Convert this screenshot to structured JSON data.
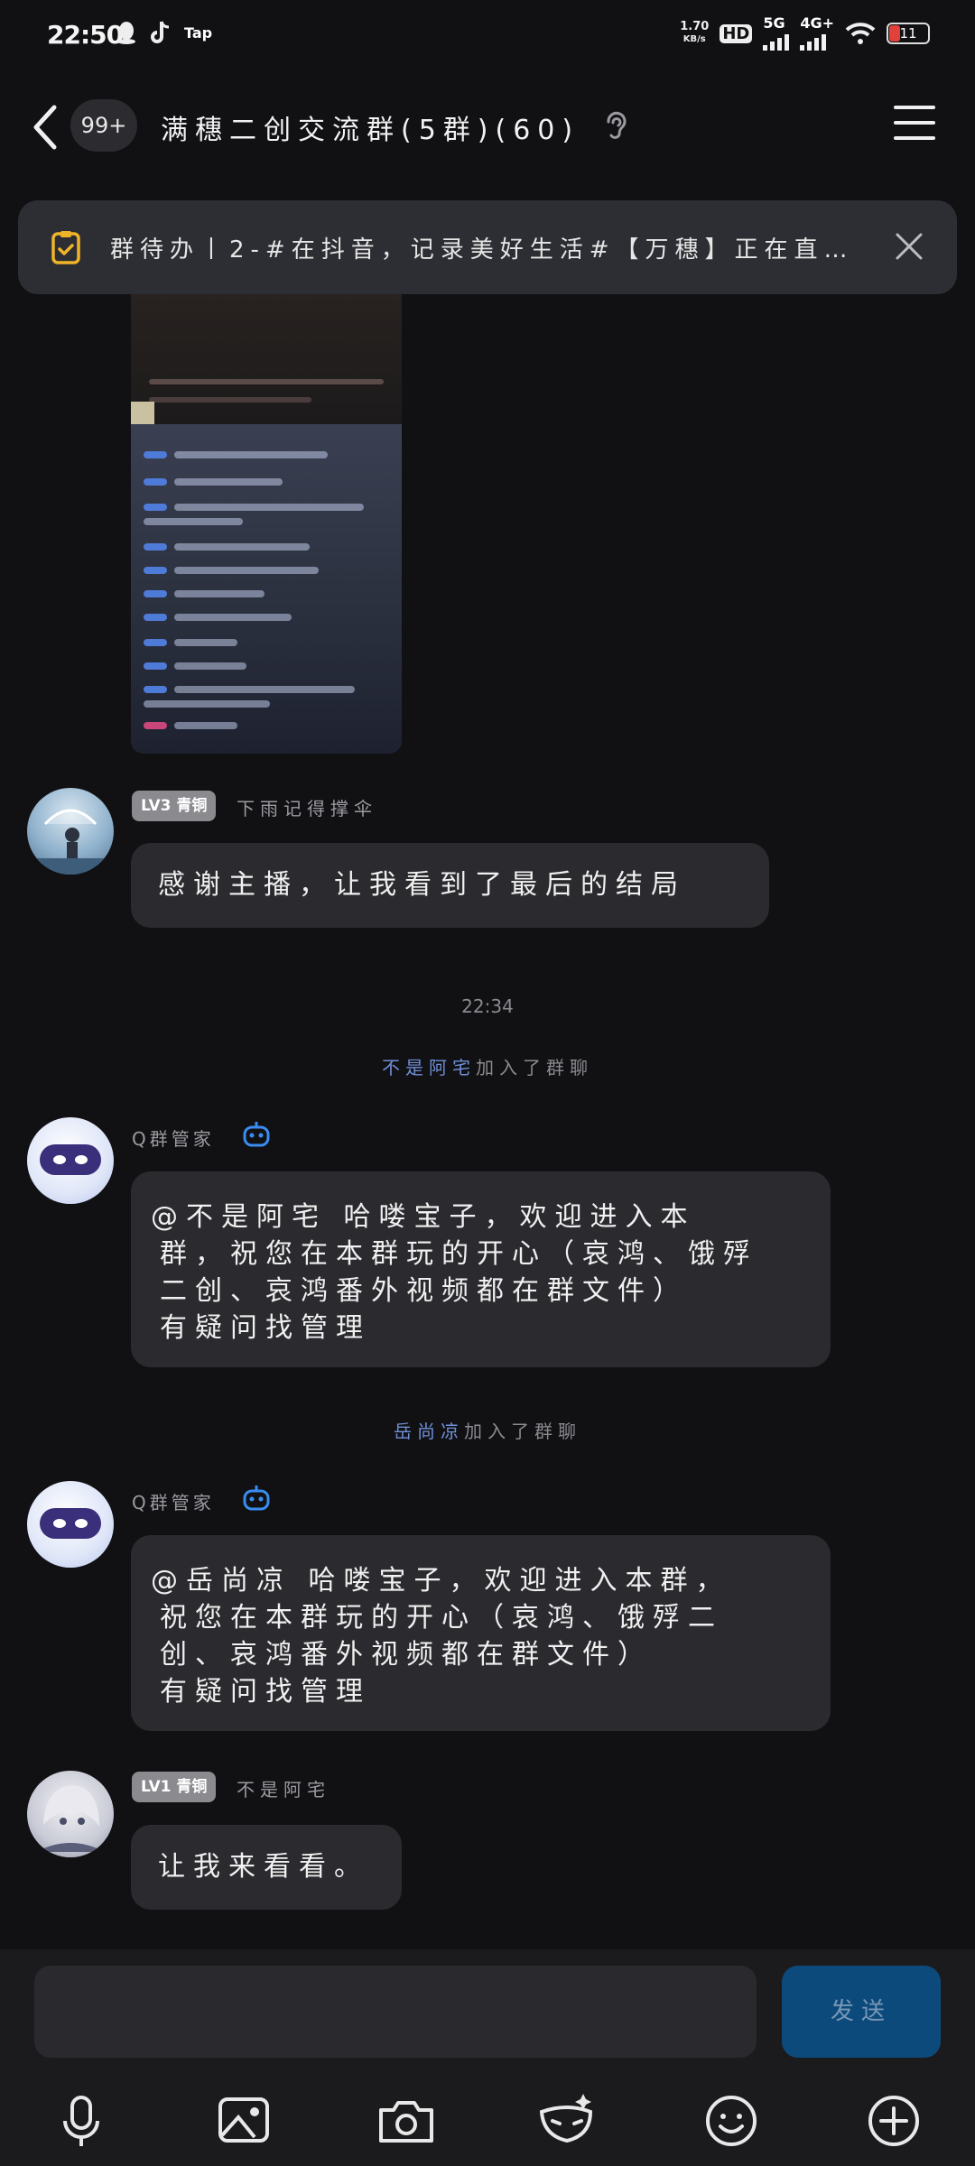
{
  "status_bar": {
    "time": "22:50",
    "net_speed_value": "1.70",
    "net_speed_unit": "KB/s",
    "hd": "HD",
    "network_1": "5G",
    "network_2": "4G+",
    "battery": "11",
    "app_tag": "Tap"
  },
  "header": {
    "unread": "99+",
    "title": "满穗二创交流群(5群)(60)"
  },
  "todo": {
    "text": "群待办丨2-#在抖音，记录美好生活#【万穗】正在直…"
  },
  "messages": {
    "m1": {
      "level": "LV3 青铜",
      "nick": "下雨记得撑伞",
      "text": "感谢主播，让我看到了最后的结局"
    },
    "time_sep": "22:34",
    "join1": {
      "who": "不是阿宅",
      "rest": "加入了群聊"
    },
    "m2": {
      "nick": "Q群管家",
      "line1": "@不是阿宅 哈喽宝子，欢迎进入本",
      "line2": "群，祝您在本群玩的开心（哀鸿、饿殍",
      "line3": "二创、哀鸿番外视频都在群文件）",
      "line4": "有疑问找管理"
    },
    "join2": {
      "who": "岳尚凉",
      "rest": "加入了群聊"
    },
    "m3": {
      "nick": "Q群管家",
      "line1": "@岳尚凉 哈喽宝子，欢迎进入本群，",
      "line2": "祝您在本群玩的开心（哀鸿、饿殍二",
      "line3": "创、哀鸿番外视频都在群文件）",
      "line4": "有疑问找管理"
    },
    "m4": {
      "level": "LV1 青铜",
      "nick": "不是阿宅",
      "text": "让我来看看。"
    }
  },
  "composer": {
    "send_label": "发送",
    "tools": [
      "microphone-icon",
      "image-icon",
      "camera-icon",
      "mask-icon",
      "emoji-icon",
      "plus-icon"
    ]
  },
  "colors": {
    "background": "#111114",
    "bubble": "#2b2b2f",
    "link_blue": "#6f8fd6",
    "send_button": "#0d4a7c",
    "todo_icon": "#f0b429"
  }
}
